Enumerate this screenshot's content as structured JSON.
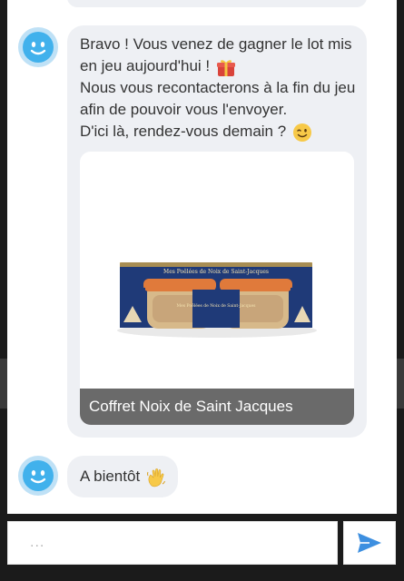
{
  "messages": [
    {
      "lines": [
        "Bravo ! Vous venez de gagner le lot mis",
        "en jeu aujourd'hui !",
        "Nous vous recontacterons à la fin du jeu",
        "afin de pouvoir vous l'envoyer.",
        "D'ici là, rendez-vous demain ?"
      ],
      "emojis": [
        "gift-icon",
        "winking-face-icon"
      ],
      "card": {
        "product_label_lines": [
          "Mes Poêlées de Noix de Saint-Jacques",
          "Mes Poêlées de Noix de Saint-Jacques"
        ],
        "caption": "Coffret Noix de Saint Jacques"
      }
    },
    {
      "text": "A bientôt",
      "emoji": "waving-hand-icon"
    }
  ],
  "composer": {
    "placeholder": "...",
    "send_icon": "send-icon"
  },
  "colors": {
    "bubble": "#eef0f4",
    "avatar_ring": "#bfe1f6",
    "avatar_face": "#41b1ec",
    "send": "#3d8fe0",
    "caption_bg": "#6a6a6a",
    "box_blue": "#1f3a78",
    "lid": "#e07a3b"
  }
}
